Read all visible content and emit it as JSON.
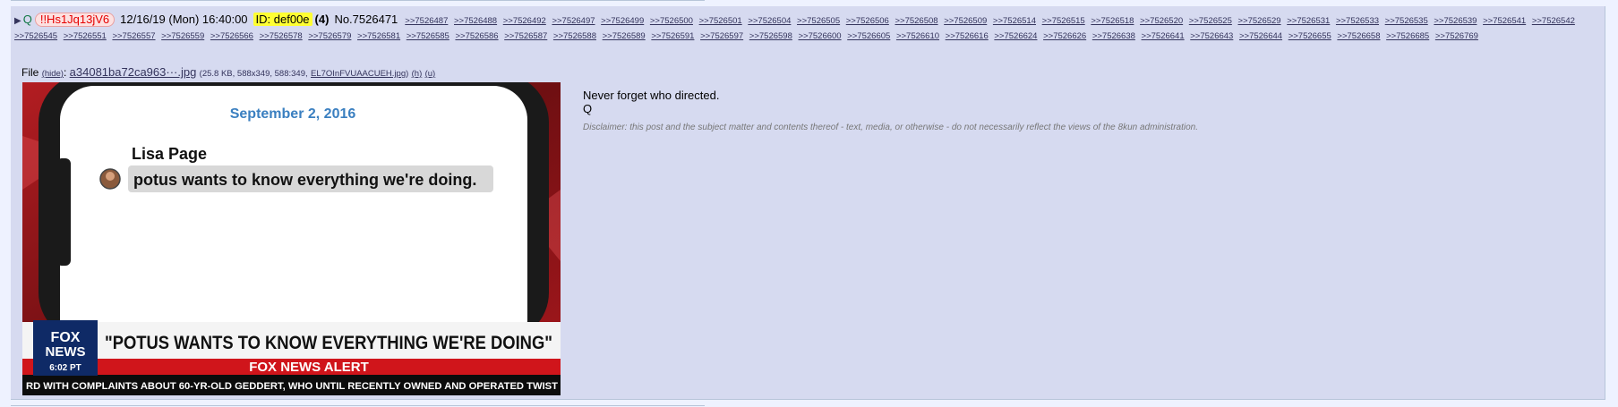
{
  "post": {
    "name": "Q",
    "tripcode": "!!Hs1Jq13jV6",
    "datetime": "12/16/19 (Mon) 16:40:00",
    "poster_id": "ID: def00e",
    "id_count": "(4)",
    "post_number": "No.7526471",
    "backlinks": [
      ">>7526487",
      ">>7526488",
      ">>7526492",
      ">>7526497",
      ">>7526499",
      ">>7526500",
      ">>7526501",
      ">>7526504",
      ">>7526505",
      ">>7526506",
      ">>7526508",
      ">>7526509",
      ">>7526514",
      ">>7526515",
      ">>7526518",
      ">>7526520",
      ">>7526525",
      ">>7526529",
      ">>7526531",
      ">>7526533",
      ">>7526535",
      ">>7526539",
      ">>7526541",
      ">>7526542",
      ">>7526545",
      ">>7526551",
      ">>7526557",
      ">>7526559",
      ">>7526566",
      ">>7526578",
      ">>7526579",
      ">>7526581",
      ">>7526585",
      ">>7526586",
      ">>7526587",
      ">>7526588",
      ">>7526589",
      ">>7526591",
      ">>7526597",
      ">>7526598",
      ">>7526600",
      ">>7526605",
      ">>7526610",
      ">>7526616",
      ">>7526624",
      ">>7526626",
      ">>7526638",
      ">>7526641",
      ">>7526643",
      ">>7526644",
      ">>7526655",
      ">>7526658",
      ">>7526685",
      ">>7526769"
    ],
    "message_lines": [
      "Never forget who directed.",
      "Q"
    ],
    "disclaimer": "Disclaimer: this post and the subject matter and contents thereof - text, media, or otherwise - do not necessarily reflect the views of the 8kun administration."
  },
  "file": {
    "prefix": "File",
    "hide": "(hide)",
    "filename": "a34081ba72ca963···.jpg",
    "meta": "(25.8 KB, 588x349, 588:349,",
    "original_name": "EL7OInFVUAACUEH.jpg",
    "meta_end": ")",
    "h": "(h)",
    "u": "(u)"
  },
  "image": {
    "date": "September 2, 2016",
    "sender": "Lisa Page",
    "message": "potus wants to know everything we're doing.",
    "fox_line1": "FOX",
    "fox_line2": "NEWS",
    "time": "6:02 PT",
    "headline": "\"POTUS WANTS TO KNOW EVERYTHING WE'RE DOING\"",
    "alert": "FOX NEWS ALERT",
    "ticker": "RD WITH COMPLAINTS ABOUT 60-YR-OLD GEDDERT, WHO UNTIL RECENTLY OWNED AND OPERATED TWIST"
  },
  "colors": {
    "post_bg": "#d6daf0",
    "page_bg": "#eef2ff",
    "tripcode": "#e50000",
    "id_highlight": "#ffff33",
    "link": "#34345c",
    "fox_red": "#d0151b",
    "fox_blue": "#0f2a66"
  }
}
